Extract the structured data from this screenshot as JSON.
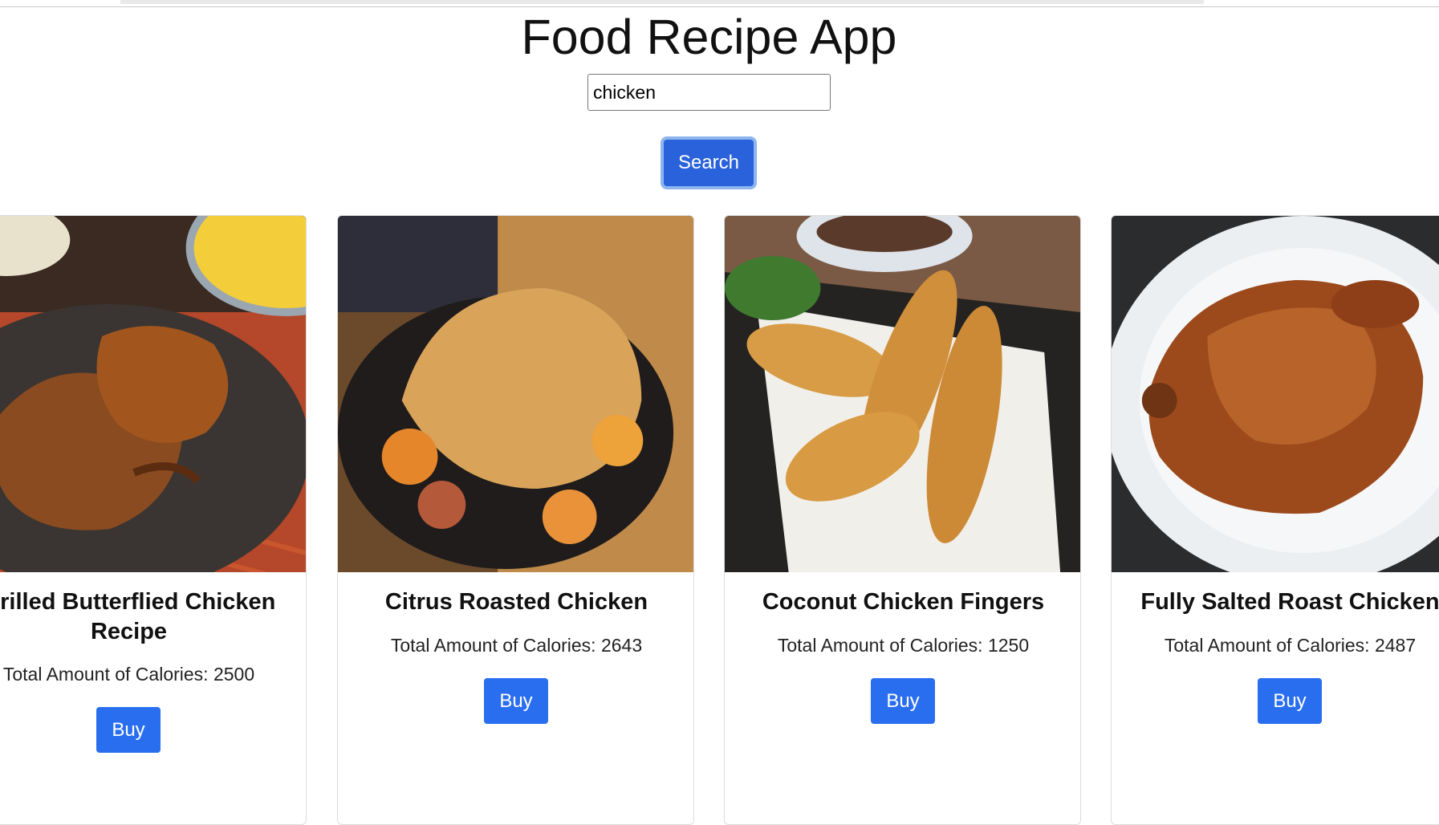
{
  "app": {
    "title": "Food Recipe App"
  },
  "search": {
    "value": "chicken",
    "button_label": "Search"
  },
  "recipes": [
    {
      "title": "Grilled Butterflied Chicken Recipe",
      "calories_label": "Total Amount of Calories: 2500",
      "buy_label": "Buy"
    },
    {
      "title": "Citrus Roasted Chicken",
      "calories_label": "Total Amount of Calories: 2643",
      "buy_label": "Buy"
    },
    {
      "title": "Coconut Chicken Fingers",
      "calories_label": "Total Amount of Calories: 1250",
      "buy_label": "Buy"
    },
    {
      "title": "Fully Salted Roast Chicken",
      "calories_label": "Total Amount of Calories: 2487",
      "buy_label": "Buy"
    }
  ],
  "colors": {
    "search_button": "#2a62dc",
    "buy_button": "#2a6ef0",
    "search_focus_ring": "#8fb5ef"
  }
}
